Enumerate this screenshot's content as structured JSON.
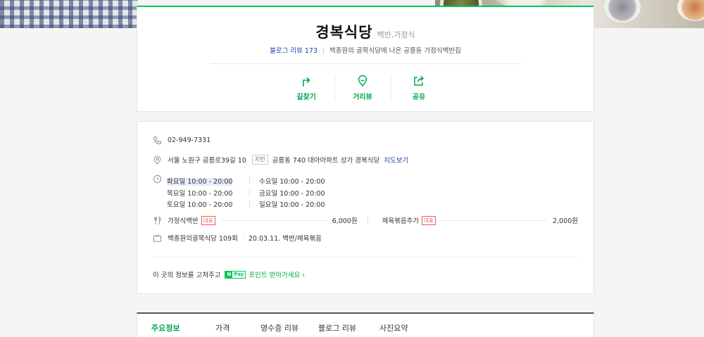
{
  "place": {
    "name": "경복식당",
    "category": "백반,가정식",
    "blog_review_label": "블로그 리뷰",
    "blog_review_count": "173",
    "description": "백종원의 골목식당에 나온 공릉동 가정식백반집"
  },
  "actions": [
    {
      "label": "길찾기",
      "icon": "directions-icon"
    },
    {
      "label": "거리뷰",
      "icon": "street-view-icon"
    },
    {
      "label": "공유",
      "icon": "share-icon"
    }
  ],
  "info": {
    "phone": "02-949-7331",
    "address": "서울 노원구 공릉로39길 10",
    "jibun_tag": "지번",
    "jibun_address": "공릉동 740 대아아파트 상가 경복식당",
    "map_link": "지도보기",
    "hours": [
      [
        "화요일 10:00 - 20:00",
        "수요일 10:00 - 20:00"
      ],
      [
        "목요일 10:00 - 20:00",
        "금요일 10:00 - 20:00"
      ],
      [
        "토요일 10:00 - 20:00",
        "일요일 10:00 - 20:00"
      ]
    ],
    "menu": [
      {
        "name": "가정식백반",
        "badge": "대표",
        "price": "6,000원"
      },
      {
        "name": "제육볶음추가",
        "badge": "대표",
        "price": "2,000원"
      }
    ],
    "tv_show": "백종원의골목식당 109회",
    "tv_detail": "20.03.11. 백반/제육볶음",
    "edit_prompt": "이 곳의 정보를 고쳐주고",
    "npay_n": "N",
    "npay_pay": "Pay",
    "point_link": "포인트 받아가세요 ›"
  },
  "tabs": [
    {
      "label": "주요정보",
      "active": true
    },
    {
      "label": "가격",
      "active": false
    },
    {
      "label": "영수증 리뷰",
      "active": false
    },
    {
      "label": "블로그 리뷰",
      "active": false
    },
    {
      "label": "사진요약",
      "active": false
    }
  ],
  "colors": {
    "accent": "#03c75a",
    "link": "#1f3da8",
    "badge": "#e85a5a"
  }
}
